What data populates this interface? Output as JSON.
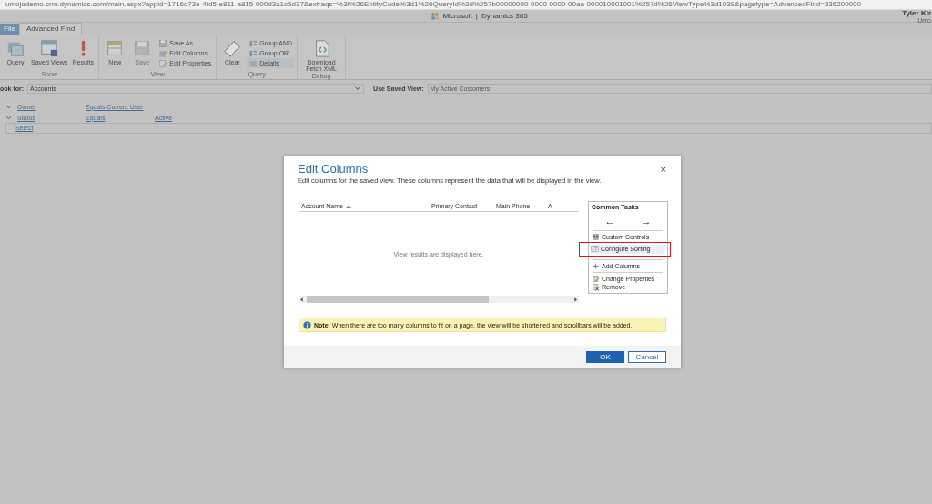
{
  "address_bar": {
    "url": "umojodemo.crm.dynamics.com/main.aspx?appid=1716d73e-4fd5-e811-a815-000d3a1c5d37&extraqs=%3f%26EntityCode%3d1%26QueryId%3d%257b00000000-0000-0000-00aa-000010001001%257d%26ViewType%3d1039&pagetype=AdvancedFind=336200000"
  },
  "top_bar": {
    "brand": "Microsoft",
    "separator": "|",
    "app": "Dynamics 365",
    "user_name": "Tyler Kir",
    "user_org": "Umo"
  },
  "tabs": [
    {
      "label": "File",
      "selected": false,
      "kind": "file"
    },
    {
      "label": "Advanced Find",
      "selected": true,
      "kind": "tab"
    }
  ],
  "ribbon": [
    {
      "group": "Show",
      "items": [
        {
          "label": "Query",
          "kind": "large"
        },
        {
          "label": "Saved Views",
          "kind": "large"
        },
        {
          "label": "Results",
          "kind": "large"
        }
      ]
    },
    {
      "group": "View",
      "items": [
        {
          "label": "New",
          "kind": "large"
        },
        {
          "label": "Save",
          "kind": "large",
          "disabled": true
        },
        {
          "label": "Save As",
          "kind": "small"
        },
        {
          "label": "Edit Columns",
          "kind": "small"
        },
        {
          "label": "Edit Properties",
          "kind": "small"
        }
      ]
    },
    {
      "group": "Query",
      "items": [
        {
          "label": "Clear",
          "kind": "large"
        },
        {
          "label": "Group AND",
          "kind": "small"
        },
        {
          "label": "Group OR",
          "kind": "small"
        },
        {
          "label": "Details",
          "kind": "small",
          "selected": true
        }
      ]
    },
    {
      "group": "Debug",
      "items": [
        {
          "label": "Download Fetch XML",
          "kind": "large"
        }
      ]
    }
  ],
  "look_for": {
    "label": "ook for:",
    "value": "Accounts"
  },
  "saved_view": {
    "label": "Use Saved View:",
    "value": "My Active Customers"
  },
  "criteria": [
    {
      "field": "Owner",
      "operator": "Equals Current User"
    },
    {
      "field": "Status",
      "operator": "Equals",
      "value": "Active"
    }
  ],
  "select_link": "Select",
  "dialog": {
    "title": "Edit Columns",
    "close": "×",
    "description": "Edit columns for the saved view. These columns represent the data that will be displayed in the view.",
    "columns": [
      "Account Name",
      "Primary Contact",
      "Main Phone",
      "A"
    ],
    "empty_text": "View results are displayed here.",
    "common_tasks": {
      "title": "Common Tasks",
      "items": [
        {
          "kind": "arrows",
          "left": "←",
          "right": "→"
        },
        {
          "kind": "divider"
        },
        {
          "kind": "task",
          "label": "Custom Controls",
          "highlighted": false
        },
        {
          "kind": "task",
          "label": "Configure Sorting",
          "highlighted": true
        },
        {
          "kind": "divider"
        },
        {
          "kind": "task",
          "label": "Add Columns",
          "highlighted": false
        },
        {
          "kind": "divider"
        },
        {
          "kind": "task",
          "label": "Change Properties",
          "highlighted": false
        },
        {
          "kind": "task",
          "label": "Remove",
          "highlighted": false
        }
      ]
    },
    "note": "**Note:** When there are too many columns to fit on a page, the view will be shortened and scrollbars will be added.",
    "buttons": [
      {
        "label": "OK",
        "kind": "primary"
      },
      {
        "label": "Cancel",
        "kind": "secondary"
      }
    ]
  }
}
